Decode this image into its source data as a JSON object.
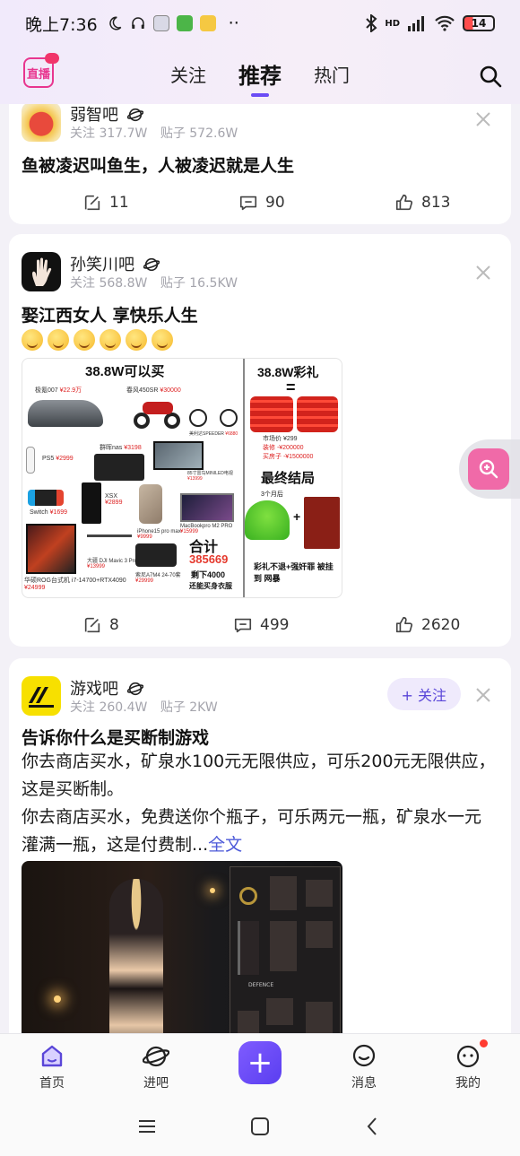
{
  "status_bar": {
    "time": "晚上7:36",
    "network": "HD",
    "battery": "14"
  },
  "header": {
    "logo_text": "直播",
    "tabs": [
      {
        "label": "关注",
        "active": false
      },
      {
        "label": "推荐",
        "active": true
      },
      {
        "label": "热门",
        "active": false
      }
    ],
    "accent_color": "#6b4cf5"
  },
  "posts": [
    {
      "forum": "弱智吧",
      "followers": "关注 317.7W",
      "posts_count": "贴子 572.6W",
      "title": "鱼被凌迟叫鱼生，人被凌迟就是人生",
      "reposts": "11",
      "comments": "90",
      "likes": "813"
    },
    {
      "forum": "孙笑川吧",
      "followers": "关注 568.8W",
      "posts_count": "贴子 16.5KW",
      "title": "娶江西女人 享快乐人生",
      "emoji_count": 6,
      "image": {
        "left_heading": "38.8W可以买",
        "items": [
          {
            "name": "极氪007",
            "price": "¥22.9万"
          },
          {
            "name": "春风450SR",
            "price": "¥30000"
          },
          {
            "name": "美利达SPEEDER",
            "price": "¥6880"
          },
          {
            "name": "PS5",
            "price": "¥2999"
          },
          {
            "name": "群晖nas",
            "price": "¥3198"
          },
          {
            "name": "85寸雷鸟MINILED电视",
            "price": "¥13999"
          },
          {
            "name": "Switch",
            "price": "¥1699"
          },
          {
            "name": "XSX",
            "price": "¥2899"
          },
          {
            "name": "MacBookpro M2 PRO",
            "price": "¥15999"
          },
          {
            "name": "iPhone15 pro max",
            "price": "¥9999"
          },
          {
            "name": "大疆 DJI Mavic 3 Pro",
            "price": "¥13999"
          },
          {
            "name": "索尼A7M4 24-70套",
            "price": "¥29999"
          },
          {
            "name": "华硕ROG台式机 i7-14700+RTX4090",
            "price": "¥24999"
          }
        ],
        "total_label": "合计",
        "total_value": "385669",
        "remaining": "剩下4000",
        "remaining_note": "还能买身衣服",
        "right_heading": "38.8W彩礼",
        "equals": "=",
        "market_price": "市场价 ¥299",
        "renovation": "装修 -¥200000",
        "house": "买房子 -¥1500000",
        "final_heading": "最终结局",
        "months_later": "3个月后",
        "plus": "+",
        "footer": "彩礼不退+强奸罪 被挂到",
        "footer_site": "网暴"
      },
      "reposts": "8",
      "comments": "499",
      "likes": "2620"
    },
    {
      "forum": "游戏吧",
      "followers": "关注 260.4W",
      "posts_count": "贴子 2KW",
      "follow_label": "+ 关注",
      "title": "告诉你什么是买断制游戏",
      "body_1": "你去商店买水，矿泉水100元无限供应，可乐200元无限供应，这是买断制。",
      "body_2": "你去商店买水，免费送你个瓶子，可乐两元一瓶，矿泉水一元灌满一瓶，这是付费制...",
      "more": "全文",
      "image_text": "DEFENCE"
    }
  ],
  "bottom_nav": [
    {
      "label": "首页",
      "icon": "home-icon",
      "active": true
    },
    {
      "label": "进吧",
      "icon": "planet-icon",
      "active": false
    },
    {
      "label": "",
      "icon": "plus-icon",
      "active": false
    },
    {
      "label": "消息",
      "icon": "message-icon",
      "active": false
    },
    {
      "label": "我的",
      "icon": "profile-icon",
      "active": false
    }
  ]
}
